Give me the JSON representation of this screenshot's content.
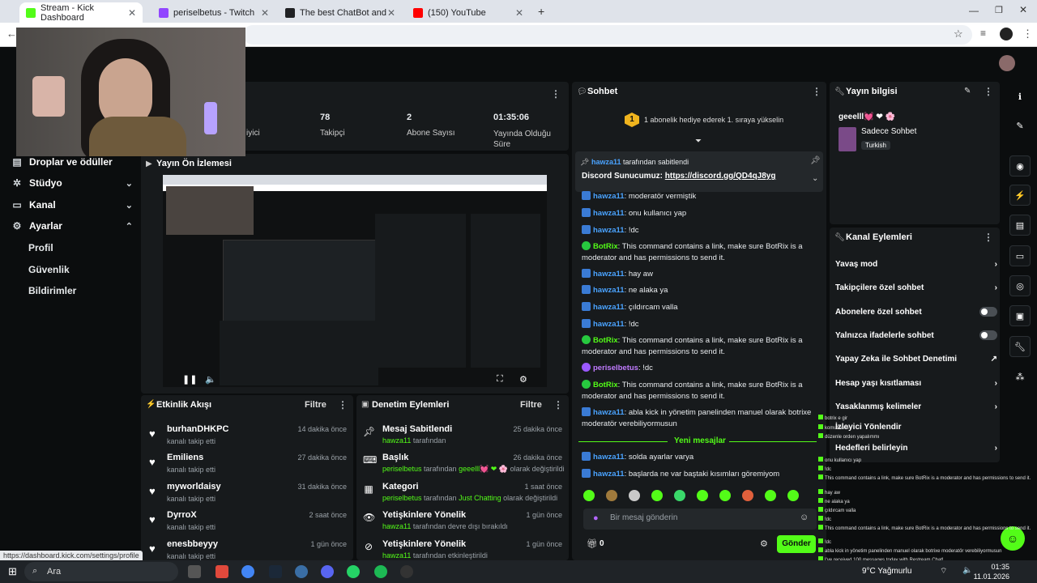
{
  "browser": {
    "tabs": [
      {
        "label": "Stream - Kick Dashboard",
        "color": "#53fc18"
      },
      {
        "label": "periselbetus - Twitch",
        "color": "#9146ff"
      },
      {
        "label": "The best ChatBot and Widgets",
        "color": "#202124"
      },
      {
        "label": "(150) YouTube",
        "color": "#ff0000"
      }
    ],
    "new_tab": "+",
    "status_url": "https://dashboard.kick.com/settings/profile"
  },
  "sidebar": {
    "items": [
      {
        "label": "Droplar ve ödüller",
        "icon": "gift-icon"
      },
      {
        "label": "Stüdyo",
        "icon": "gear-icon"
      },
      {
        "label": "Kanal",
        "icon": "tv-icon"
      },
      {
        "label": "Ayarlar",
        "icon": "gear-icon"
      }
    ],
    "subitems": [
      "Profil",
      "Güvenlik",
      "Bildirimler"
    ]
  },
  "stats": [
    {
      "value": "78",
      "label": "Takipçi"
    },
    {
      "value": "2",
      "label": "Abone Sayısı"
    },
    {
      "value": "01:35:06",
      "label": "Yayında Olduğu Süre"
    }
  ],
  "stats_partial": "iyici",
  "preview": {
    "title": "Yayın Ön İzlemesi"
  },
  "activity": {
    "title": "Etkinlik Akışı",
    "filter": "Filtre",
    "rows": [
      {
        "name": "burhanDHKPC",
        "sub": "kanalı takip etti",
        "time": "14 dakika önce"
      },
      {
        "name": "Emiliens",
        "sub": "kanalı takip etti",
        "time": "27 dakika önce"
      },
      {
        "name": "myworldaisy",
        "sub": "kanalı takip etti",
        "time": "31 dakika önce"
      },
      {
        "name": "DyrroX",
        "sub": "kanalı takip etti",
        "time": "2 saat önce"
      },
      {
        "name": "enesbbeyyy",
        "sub": "kanalı takip etti",
        "time": "1 gün önce"
      }
    ]
  },
  "moderation": {
    "title": "Denetim Eylemleri",
    "filter": "Filtre",
    "rows": [
      {
        "title": "Mesaj Sabitlendi",
        "user": "hawza11",
        "rest": " tarafından",
        "highlight": "",
        "tail": "",
        "time": "25 dakika önce"
      },
      {
        "title": "Başlık",
        "user": "periselbetus",
        "rest": " tarafından ",
        "highlight": "geeelll💓 ❤ 🌸",
        "tail": " olarak değiştirildi",
        "time": "26 dakika önce"
      },
      {
        "title": "Kategori",
        "user": "periselbetus",
        "rest": " tarafından ",
        "highlight": "Just Chatting",
        "tail": " olarak değiştirildi",
        "time": "1 saat önce"
      },
      {
        "title": "Yetişkinlere Yönelik",
        "user": "hawza11",
        "rest": " tarafından devre dışı bırakıldı",
        "highlight": "",
        "tail": "",
        "time": "1 gün önce"
      },
      {
        "title": "Yetişkinlere Yönelik",
        "user": "hawza11",
        "rest": " tarafından etkinleştirildi",
        "highlight": "",
        "tail": "",
        "time": "1 gün önce"
      }
    ]
  },
  "chat": {
    "title": "Sohbet",
    "gift_banner": "1 abonelik hediye ederek 1. sıraya yükselin",
    "gift_rank": "1",
    "pinned": {
      "by": "hawza11",
      "by_suffix": " tarafından sabitlendi",
      "text": "Discord Sunucumuz: ",
      "link": "https://discord.gg/QD4qJ8yg"
    },
    "messages": [
      {
        "user": "hawza11",
        "type": "mod",
        "text": ": moderatör vermiştik"
      },
      {
        "user": "hawza11",
        "type": "mod",
        "text": ": onu kullanıcı yap"
      },
      {
        "user": "hawza11",
        "type": "mod",
        "text": ": !dc"
      },
      {
        "user": "BotRix",
        "type": "bot",
        "text": ": This command contains a link, make sure BotRix is a moderator and has permissions to send it."
      },
      {
        "user": "hawza11",
        "type": "mod",
        "text": ": hay aw"
      },
      {
        "user": "hawza11",
        "type": "mod",
        "text": ": ne alaka ya"
      },
      {
        "user": "hawza11",
        "type": "mod",
        "text": ": çıldırcam valla"
      },
      {
        "user": "hawza11",
        "type": "mod",
        "text": ": !dc"
      },
      {
        "user": "BotRix",
        "type": "bot",
        "text": ": This command contains a link, make sure BotRix is a moderator and has permissions to send it."
      },
      {
        "user": "periselbetus",
        "type": "peri",
        "text": ": !dc"
      },
      {
        "user": "BotRix",
        "type": "bot",
        "text": ": This command contains a link, make sure BotRix is a moderator and has permissions to send it."
      },
      {
        "user": "hawza11",
        "type": "mod",
        "text": ": abla kick in yönetim panelinden manuel olarak botrixe moderatör verebiliyormusun"
      }
    ],
    "new_messages": "Yeni mesajlar",
    "new": [
      {
        "user": "hawza11",
        "type": "mod",
        "text": ": solda ayarlar varya"
      },
      {
        "user": "hawza11",
        "type": "mod",
        "text": ": başlarda ne var baştaki kısımları göremiyom"
      }
    ],
    "input_placeholder": "Bir mesaj gönderin",
    "points": "0",
    "send": "Gönder"
  },
  "stream_info": {
    "title": "Yayın bilgisi",
    "stream_title": "geeelll💓 ❤ 🌸",
    "category": "Sadece Sohbet",
    "language": "Turkish"
  },
  "channel_actions": {
    "title": "Kanal Eylemleri",
    "rows": [
      {
        "label": "Yavaş mod",
        "control": "chevron"
      },
      {
        "label": "Takipçilere özel sohbet",
        "control": "chevron"
      },
      {
        "label": "Abonelere özel sohbet",
        "control": "toggle"
      },
      {
        "label": "Yalnızca ifadelerle sohbet",
        "control": "toggle"
      },
      {
        "label": "Yapay Zeka ile Sohbet Denetimi",
        "control": "external"
      },
      {
        "label": "Hesap yaşı kısıtlaması",
        "control": "chevron"
      },
      {
        "label": "Yasaklanmış kelimeler",
        "control": "chevron"
      },
      {
        "label": "İzleyici Yönlendir",
        "control": "none"
      },
      {
        "label": "Hedefleri belirleyin",
        "control": "chevron"
      }
    ]
  },
  "overlay_chat": [
    "botrix e gir",
    "komutlarım",
    "düzenle orden yapalımmı",
    "onu kullanıcı yap",
    "!dc",
    "This command contains a link, make sure BotRix is a moderator and has permissions to send it.",
    "hay aw",
    "ne alaka ya",
    "çıldırcam valla",
    "!dc",
    "This command contains a link, make sure BotRix is a moderator and has permissions to send it.",
    "!dc",
    "abla kick in yönetim panelinden manuel olarak botrixe moderatör verebiliyormusun",
    "I've received 100 messages today with Restream Chat!",
    "başlarda ne var baştaki kısımları göremiyom"
  ],
  "taskbar": {
    "search": "Ara",
    "weather": "9°C Yağmurlu",
    "time": "01:35",
    "date": "11.01.2026"
  },
  "colors": {
    "accent": "#53fc18",
    "panel": "#171a1c",
    "bg": "#0b0d0e"
  }
}
